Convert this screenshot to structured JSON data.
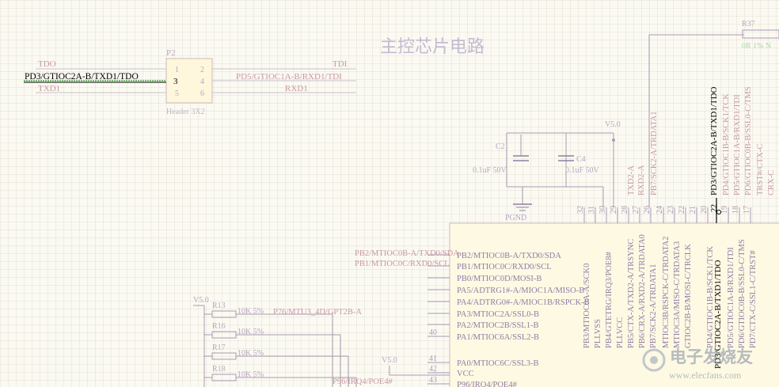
{
  "title": "主控芯片电路",
  "connector": {
    "ref": "P2",
    "part": "Header 3X2",
    "pins_left": [
      "1",
      "3",
      "5"
    ],
    "pins_right": [
      "2",
      "4",
      "6"
    ],
    "left_nets": [
      "TDO",
      "PD3/GTIOC2A-B/TXD1/TDO",
      "TXD1"
    ],
    "right_nets": [
      "TDI",
      "PD5/GTIOC1A-B/RXD1/TDI",
      "RXD1"
    ]
  },
  "power": {
    "v50": "V5.0",
    "pgnd": "PGND",
    "vcc": "VCC"
  },
  "caps": [
    {
      "ref": "C2",
      "value": "0.1uF 50V"
    },
    {
      "ref": "C4",
      "value": "0.1uF 50V"
    }
  ],
  "resistors": [
    {
      "ref": "R13",
      "value": "10K 5%",
      "net": "P76/MTU3_4D/GPT2B-A"
    },
    {
      "ref": "R16",
      "value": "10K 5%",
      "net": ""
    },
    {
      "ref": "R17",
      "value": "10K 5%",
      "net": ""
    },
    {
      "ref": "R18",
      "value": "10K 5%",
      "net": ""
    }
  ],
  "r37": {
    "ref": "R37",
    "value": "0R 1% N"
  },
  "left_nets": [
    "PB2/MTIOC0B-A/TXD0/SDA",
    "PB1/MTIOC0C/RXD0/SCL"
  ],
  "bottom_net": "P96/IRQ4/POE4#",
  "left_pins": [
    {
      "num": "",
      "name": "PB2/MTIOC0B-A/TXD0/SDA"
    },
    {
      "num": "",
      "name": "PB1/MTIOC0C/RXD0/SCL"
    },
    {
      "num": "",
      "name": "PB0/MTIOC0D/MOSI-B"
    },
    {
      "num": "",
      "name": "PA5/ADTRG1#-A/MIOC1A/MISO-B"
    },
    {
      "num": "",
      "name": "PA4/ADTRG0#-A/MIOC1B/RSPCK-B"
    },
    {
      "num": "",
      "name": "PA3/MTIOC2A/SSL0-B"
    },
    {
      "num": "",
      "name": "PA2/MTIOC2B/SSL1-B"
    },
    {
      "num": "40",
      "name": "PA1/MTIOC6A/SSL2-B"
    },
    {
      "num": "41",
      "name": "PA0/MTIOC6C/SSL3-B"
    },
    {
      "num": "42",
      "name": "VCC"
    },
    {
      "num": "43",
      "name": "P96/IRQ4/POE4#"
    }
  ],
  "top_pin_nums": [
    "32",
    "31",
    "30",
    "29",
    "28",
    "27",
    "26",
    "24",
    "23",
    "22",
    "21",
    "20",
    "19",
    "18",
    "17"
  ],
  "top_labels": [
    "TXD2-A",
    "RXD2-A",
    "PB7/SCK2-A/TRDATA1",
    "PD3/GTIOC2A-B/TXD1/TDO",
    "PD4/GTIOC1B-B/SCK1/TCK",
    "PD5/GTIOC1A-B/RXD1/TDI",
    "PD6/GTIOC0B-B/SSL0-C/TMS",
    "TRST#/CTX-C",
    "CRX-C"
  ],
  "chip_top_pins": [
    "PB3/MTIOC0A-A/SCK0",
    "PLLVSS",
    "PB4/GTETRG/IRQ3/POE8#",
    "PLLVCC",
    "PB5/CTX-A/TXD2-A/TRSYNC",
    "PB6/CRX-A/RXD2-A/TRDATA0",
    "PB7/SCK2-A/TRDATA1",
    "MTIOC3B/RSPCK-C/TRDATA2",
    "MTIOC3A/MISO-C/TRDATA3",
    "GTIOC2B-B/MOSI-C/TRCLK",
    "PD3/GTIOC2A-B/TXD1/TDO",
    "PD4/GTIOC1B-B/SCK1/TCK",
    "PD5/GTIOC1A-B/RXD1/TDI",
    "PD6/GTIOC0B-B/SSL0-C/TMS",
    "PD7/CTX-C/SSL1-C/TRST#"
  ],
  "highlight_pin": {
    "num": "22",
    "name": "PD3/GTIOC2A-B/TXD1/TDO"
  },
  "watermark": {
    "line1": "电子发烧友",
    "line2": "www.elecfans.com"
  },
  "colors": {
    "background": "#fbfaf2",
    "chip_fill": "#fef9e3",
    "wire": "#8a7aa0",
    "highlight": "#000000",
    "net_label": "#c69aa6",
    "probe": "#3bb43b"
  }
}
